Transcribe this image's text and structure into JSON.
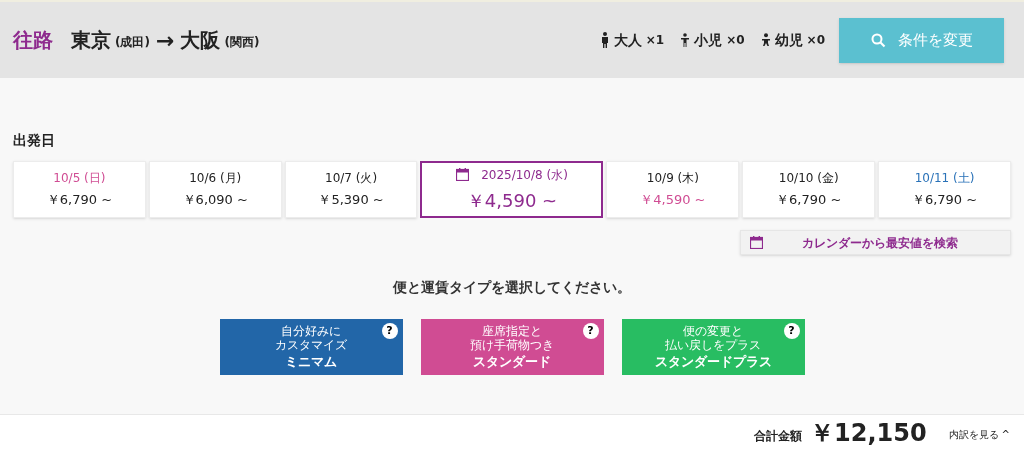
{
  "header": {
    "direction": "往路",
    "origin": "東京",
    "origin_airport": "(成田)",
    "arrow": "→",
    "destination": "大阪",
    "destination_airport": "(関西)",
    "passengers": [
      {
        "kind": "adult",
        "label": "大人",
        "count": "×1"
      },
      {
        "kind": "child",
        "label": "小児",
        "count": "×0"
      },
      {
        "kind": "infant",
        "label": "幼児",
        "count": "×0"
      }
    ],
    "change_button": "条件を変更"
  },
  "departure_label": "出発日",
  "dates": [
    {
      "date": "10/5 (日)",
      "price": "￥6,790 ~",
      "color": "#d04c93",
      "cheapest": false,
      "selected": false
    },
    {
      "date": "10/6 (月)",
      "price": "￥6,090 ~",
      "color": "#222222",
      "cheapest": false,
      "selected": false
    },
    {
      "date": "10/7 (火)",
      "price": "￥5,390 ~",
      "color": "#222222",
      "cheapest": false,
      "selected": false
    },
    {
      "date": "2025/10/8 (水)",
      "price": "￥4,590 ~",
      "color": "#8e2a8e",
      "selected": true
    },
    {
      "date": "10/9 (木)",
      "price": "￥4,590 ~",
      "color": "#222222",
      "cheapest": true,
      "selected": false
    },
    {
      "date": "10/10 (金)",
      "price": "￥6,790 ~",
      "color": "#222222",
      "cheapest": false,
      "selected": false
    },
    {
      "date": "10/11 (土)",
      "price": "￥6,790 ~",
      "color": "#2a72b8",
      "cheapest": false,
      "selected": false
    }
  ],
  "calendar_search": "カレンダーから最安値を検索",
  "instruction": "便と運賃タイプを選択してください。",
  "fare_types": [
    {
      "description": [
        "自分好みに",
        "カスタマイズ"
      ],
      "name": "ミニマム",
      "color": "#2266a8",
      "help": "?"
    },
    {
      "description": [
        "座席指定と",
        "預け手荷物つき"
      ],
      "name": "スタンダード",
      "color": "#d04c93",
      "help": "?"
    },
    {
      "description": [
        "便の変更と",
        "払い戻しをプラス"
      ],
      "name": "スタンダードプラス",
      "color": "#28bd62",
      "help": "?"
    }
  ],
  "footer": {
    "total_label": "合計金額",
    "total": "￥12,150",
    "details_link": "内訳を見る",
    "details_caret": "^"
  }
}
